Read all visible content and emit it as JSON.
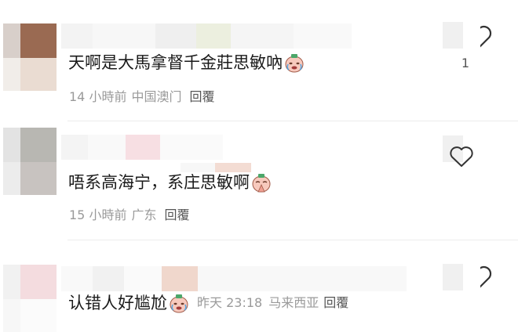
{
  "comments": [
    {
      "text": "天啊是大馬拿督千金莊思敏吶",
      "emoji": "crying-face-sticker",
      "time": "14 小時前",
      "location": "中国澳门",
      "reply": "回覆",
      "likes": "1"
    },
    {
      "text": "唔系高海宁，系庄思敏啊",
      "emoji": "praying-face-sticker",
      "time": "15 小時前",
      "location": "广东",
      "reply": "回覆",
      "likes": ""
    },
    {
      "text": "认错人好尴尬",
      "emoji": "crying-face-sticker",
      "time": "昨天 23:18",
      "location": "马来西亚",
      "reply": "回覆",
      "likes": ""
    }
  ],
  "colors": {
    "text": "#1a1a1a",
    "meta": "#9a9a9a",
    "reply": "#555555"
  }
}
